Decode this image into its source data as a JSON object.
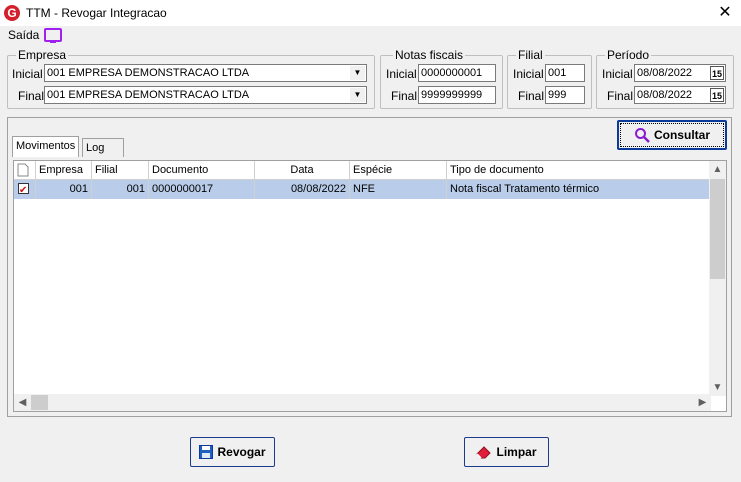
{
  "window": {
    "title": "TTM - Revogar Integracao",
    "app_icon_letter": "G",
    "close_glyph": "✕"
  },
  "menu": {
    "saida_label": "Saída"
  },
  "empresa": {
    "legend": "Empresa",
    "inicial_label": "Inicial",
    "final_label": "Final",
    "inicial_value": "001 EMPRESA DEMONSTRACAO LTDA",
    "final_value": "001 EMPRESA DEMONSTRACAO LTDA"
  },
  "notas": {
    "legend": "Notas fiscais",
    "inicial_label": "Inicial",
    "final_label": "Final",
    "inicial_value": "0000000001",
    "final_value": "9999999999"
  },
  "filial": {
    "legend": "Filial",
    "inicial_label": "Inicial",
    "final_label": "Final",
    "inicial_value": "001",
    "final_value": "999"
  },
  "periodo": {
    "legend": "Período",
    "inicial_label": "Inicial",
    "final_label": "Final",
    "inicial_value": "08/08/2022",
    "final_value": "08/08/2022",
    "calendar_glyph": "15"
  },
  "tabs": {
    "movimentos": "Movimentos",
    "log": "Log"
  },
  "consultar_label": "Consultar",
  "grid": {
    "headers": {
      "empresa": "Empresa",
      "filial": "Filial",
      "documento": "Documento",
      "data": "Data",
      "especie": "Espécie",
      "tipo": "Tipo de documento"
    },
    "rows": [
      {
        "empresa": "001",
        "filial": "001",
        "documento": "0000000017",
        "data": "08/08/2022",
        "especie": "NFE",
        "tipo": "Nota fiscal Tratamento térmico",
        "checked": true
      }
    ]
  },
  "buttons": {
    "revogar": "Revogar",
    "limpar": "Limpar"
  },
  "colors": {
    "accent": "#0a3a9a",
    "selection": "#b9cdea",
    "app_icon": "#d4202c",
    "monitor_icon": "#a020f0"
  }
}
